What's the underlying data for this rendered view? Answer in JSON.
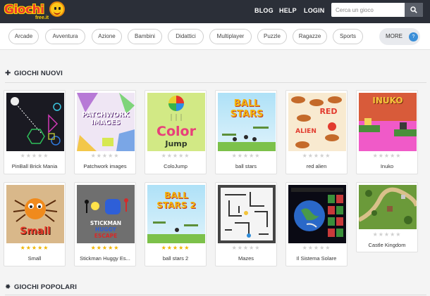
{
  "header": {
    "logo_text": "Giochi",
    "logo_sub": "free.it",
    "links": [
      {
        "label": "BLOG",
        "name": "blog"
      },
      {
        "label": "HELP",
        "name": "help"
      },
      {
        "label": "LOGIN",
        "name": "login"
      }
    ],
    "search_placeholder": "Cerca un gioco"
  },
  "categories": [
    "Arcade",
    "Avventura",
    "Azione",
    "Bambini",
    "Didattici",
    "Multiplayer",
    "Puzzle",
    "Ragazze",
    "Sports"
  ],
  "more": {
    "label": "MORE",
    "badge": "?"
  },
  "sections": {
    "new_title": "GIOCHI NUOVI",
    "popular_title": "GIOCHI POPOLARI"
  },
  "games": [
    {
      "title": "PinBall Brick Mania",
      "stars": 0,
      "thumb_text": ""
    },
    {
      "title": "Patchwork images",
      "stars": 0,
      "thumb_text": "PATCHWORK IMAGES"
    },
    {
      "title": "ColoJump",
      "stars": 0,
      "thumb_text": "Color Jump"
    },
    {
      "title": "ball stars",
      "stars": 0,
      "thumb_text": "BALL STARS"
    },
    {
      "title": "red alien",
      "stars": 0,
      "thumb_text": "RED ALIEN"
    },
    {
      "title": "Inuko",
      "stars": 0,
      "thumb_text": "INUKO"
    },
    {
      "title": "Small",
      "stars": 5,
      "thumb_text": "Small"
    },
    {
      "title": "Stickman Huggy Es...",
      "stars": 5,
      "thumb_text": "STICKMAN HUGGY ESCAPE"
    },
    {
      "title": "ball stars 2",
      "stars": 5,
      "thumb_text": "BALL STARS 2"
    },
    {
      "title": "Mazes",
      "stars": 0,
      "thumb_text": ""
    },
    {
      "title": "Il Sistema Solare",
      "stars": 0,
      "thumb_text": ""
    },
    {
      "title": "Castle Kingdom",
      "stars": 0,
      "thumb_text": ""
    }
  ],
  "colors": {
    "topbar": "#2b2f38",
    "star_on": "#f0b400",
    "star_off": "#cfcfcf",
    "badge": "#3b8fd8"
  }
}
